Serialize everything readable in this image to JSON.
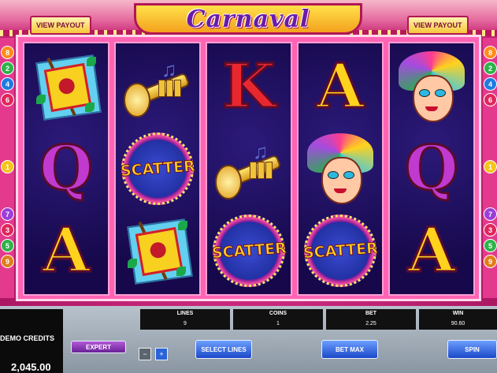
{
  "game": {
    "logo_text": "Carnaval",
    "view_payout_left": "VIEW PAYOUT",
    "view_payout_right": "VIEW PAYOUT"
  },
  "paylines": {
    "left": [
      "8",
      "2",
      "4",
      "6",
      "1",
      "7",
      "3",
      "5",
      "9"
    ],
    "right": [
      "8",
      "2",
      "4",
      "6",
      "1",
      "7",
      "3",
      "5",
      "9"
    ],
    "colors": [
      "#ff8c1a",
      "#2db34a",
      "#1f7be0",
      "#e0265c",
      "#f2c61a",
      "#9b3ed8",
      "#e0265c",
      "#2db34a",
      "#e07e1a"
    ]
  },
  "reels": [
    [
      "flag",
      "Q",
      "A"
    ],
    [
      "trumpet",
      "SCATTER",
      "flag"
    ],
    [
      "K",
      "trumpet",
      "SCATTER"
    ],
    [
      "A",
      "mask",
      "SCATTER"
    ],
    [
      "mask",
      "Q",
      "A"
    ]
  ],
  "scatter_text": "SCATTER",
  "panel": {
    "credits_label": "DEMO CREDITS",
    "credits_value": "2,045.00",
    "lines_label": "LINES",
    "lines_value": "9",
    "coins_label": "COINS",
    "coins_value": "1",
    "bet_label": "BET",
    "bet_value": "2.25",
    "win_label": "WIN",
    "win_value": "90.60",
    "expert_label": "EXPERT",
    "select_lines_label": "SELECT LINES",
    "bet_max_label": "BET MAX",
    "spin_label": "SPIN",
    "minus_symbol": "−",
    "plus_symbol": "+"
  },
  "colors": {
    "accent_blue": "#1a48c8",
    "expert_purple": "#6a2197",
    "reel_bg": "#16084a"
  }
}
